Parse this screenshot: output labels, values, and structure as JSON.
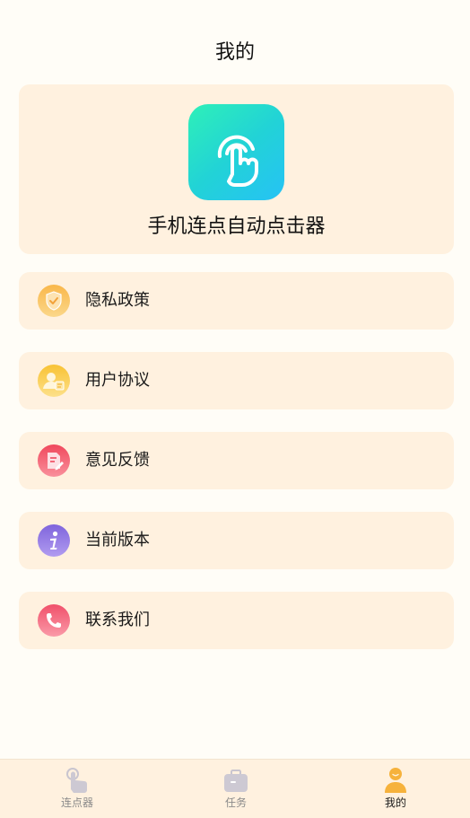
{
  "header": {
    "title": "我的"
  },
  "app": {
    "name": "手机连点自动点击器",
    "logo_icon": "tap-hand-icon"
  },
  "menu": {
    "items": [
      {
        "label": "隐私政策",
        "icon": "shield-check-icon",
        "color": "#f7a53c"
      },
      {
        "label": "用户协议",
        "icon": "user-document-icon",
        "color": "#f6c84a"
      },
      {
        "label": "意见反馈",
        "icon": "feedback-edit-icon",
        "color": "#f2596a"
      },
      {
        "label": "当前版本",
        "icon": "info-icon",
        "color": "#8b6fe0"
      },
      {
        "label": "联系我们",
        "icon": "phone-icon",
        "color": "#f2637a"
      }
    ]
  },
  "tabbar": {
    "tabs": [
      {
        "label": "连点器",
        "icon": "tap-finger-icon",
        "active": false
      },
      {
        "label": "任务",
        "icon": "briefcase-icon",
        "active": false
      },
      {
        "label": "我的",
        "icon": "person-icon",
        "active": true
      }
    ]
  },
  "colors": {
    "background": "#fffdf7",
    "card": "#fff1df",
    "accent": "#f6b23c"
  }
}
